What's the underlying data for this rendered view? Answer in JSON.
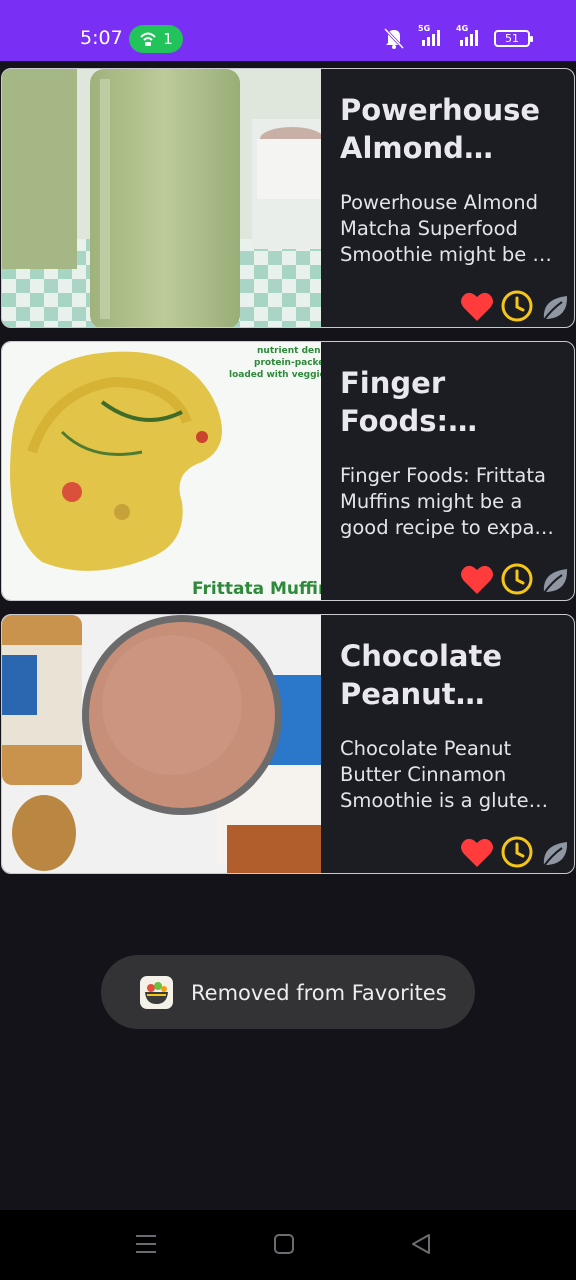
{
  "status_bar": {
    "time": "5:07",
    "hotspot_count": "1",
    "network_5g": "5G",
    "network_4g": "4G",
    "battery": "51",
    "accent": "#7a2ff5"
  },
  "recipes": [
    {
      "title": "Powerhouse Almond Matcha Superfood Smoothie",
      "description": "Powerhouse Almond Matcha Superfood Smoothie might be a good recipe to expand your breakfast recipe box.",
      "image": "green matcha smoothie glass",
      "favorite": true
    },
    {
      "title": "Finger Foods: Frittata Muffins",
      "description": "Finger Foods: Frittata Muffins might be a good recipe to expand your finger food recipe box.",
      "image": "frittata muffin",
      "image_caption": "Frittata Muffin",
      "image_corner_text": "nutrient dense protein-packed loaded with veggies",
      "favorite": true
    },
    {
      "title": "Chocolate Peanut Butter Cinnamon Smoothie",
      "description": "Chocolate Peanut Butter Cinnamon Smoothie is a gluten free recipe.",
      "image": "chocolate peanut butter smoothie",
      "favorite": true
    }
  ],
  "card_icons": [
    "heart-icon",
    "clock-icon",
    "leaf-icon"
  ],
  "colors": {
    "heart": "#ff3b3b",
    "clock": "#f5c518",
    "leaf": "#8f97a3"
  },
  "toast": {
    "message": "Removed from Favorites"
  }
}
